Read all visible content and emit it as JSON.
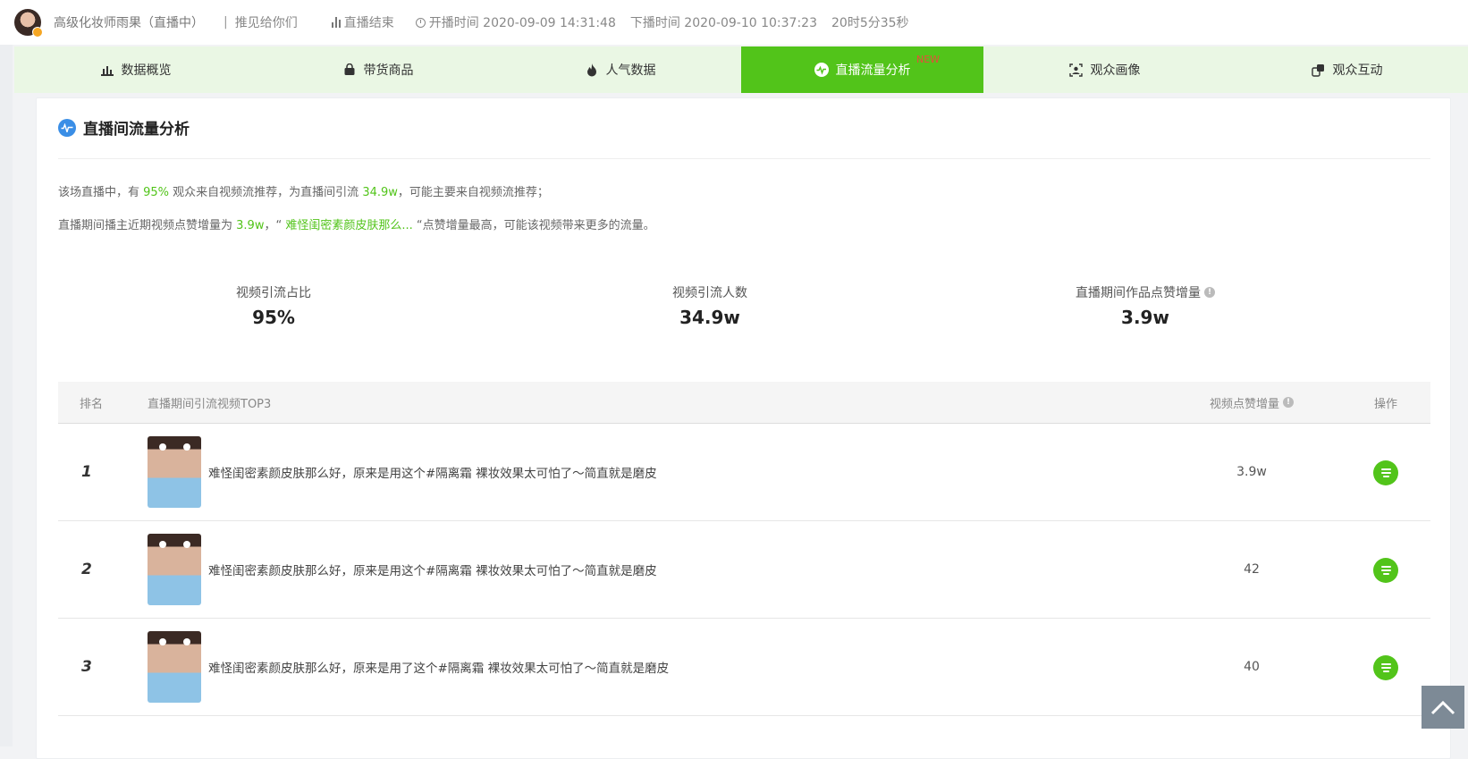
{
  "header": {
    "streamer_name": "高级化妆师雨果（直播中）",
    "separator": "|",
    "share_text": "推见给你们",
    "status_text": "直播结束",
    "start_label": "开播时间 2020-09-09 14:31:48",
    "end_label": "下播时间 2020-09-10 10:37:23",
    "duration": "20时5分35秒"
  },
  "tabs": [
    {
      "label": "数据概览",
      "icon": "bar-chart-icon"
    },
    {
      "label": "带货商品",
      "icon": "shopping-bag-icon"
    },
    {
      "label": "人气数据",
      "icon": "flame-icon"
    },
    {
      "label": "直播流量分析",
      "icon": "pulse-icon",
      "badge": "NEW",
      "active": true
    },
    {
      "label": "观众画像",
      "icon": "portrait-icon"
    },
    {
      "label": "观众互动",
      "icon": "interaction-icon"
    }
  ],
  "card": {
    "title": "直播间流量分析",
    "summary1": {
      "p1": "该场直播中，有 ",
      "pct": "95%",
      "p2": " 观众来自视频流推荐，为直播间引流 ",
      "count": "34.9w",
      "p3": "，可能主要来自视频流推荐；"
    },
    "summary2": {
      "p1": "直播期间播主近期视频点赞增量为 ",
      "likes": "3.9w",
      "p2": "，“ ",
      "video": "难怪闺密素颜皮肤那么...",
      "p3": " “点赞增量最高，可能该视频带来更多的流量。"
    }
  },
  "metrics": [
    {
      "label": "视频引流占比",
      "value": "95%"
    },
    {
      "label": "视频引流人数",
      "value": "34.9w"
    },
    {
      "label": "直播期间作品点赞增量",
      "value": "3.9w",
      "info": "!"
    }
  ],
  "table": {
    "headers": {
      "rank": "排名",
      "video": "直播期间引流视频TOP3",
      "likes": "视频点赞增量",
      "info": "!",
      "op": "操作"
    },
    "rows": [
      {
        "rank": "1",
        "title": "难怪闺密素颜皮肤那么好，原来是用这个#隔离霜 裸妆效果太可怕了～简直就是磨皮",
        "likes": "3.9w"
      },
      {
        "rank": "2",
        "title": "难怪闺密素颜皮肤那么好，原来是用这个#隔离霜 裸妆效果太可怕了～简直就是磨皮",
        "likes": "42"
      },
      {
        "rank": "3",
        "title": "难怪闺密素颜皮肤那么好，原来是用了这个#隔离霜 裸妆效果太可怕了～简直就是磨皮",
        "likes": "40"
      }
    ]
  },
  "colors": {
    "accent": "#52c41a",
    "tab_bg": "#eaf7e4",
    "badge": "#e74c3c",
    "back_top": "#7d8a96"
  }
}
